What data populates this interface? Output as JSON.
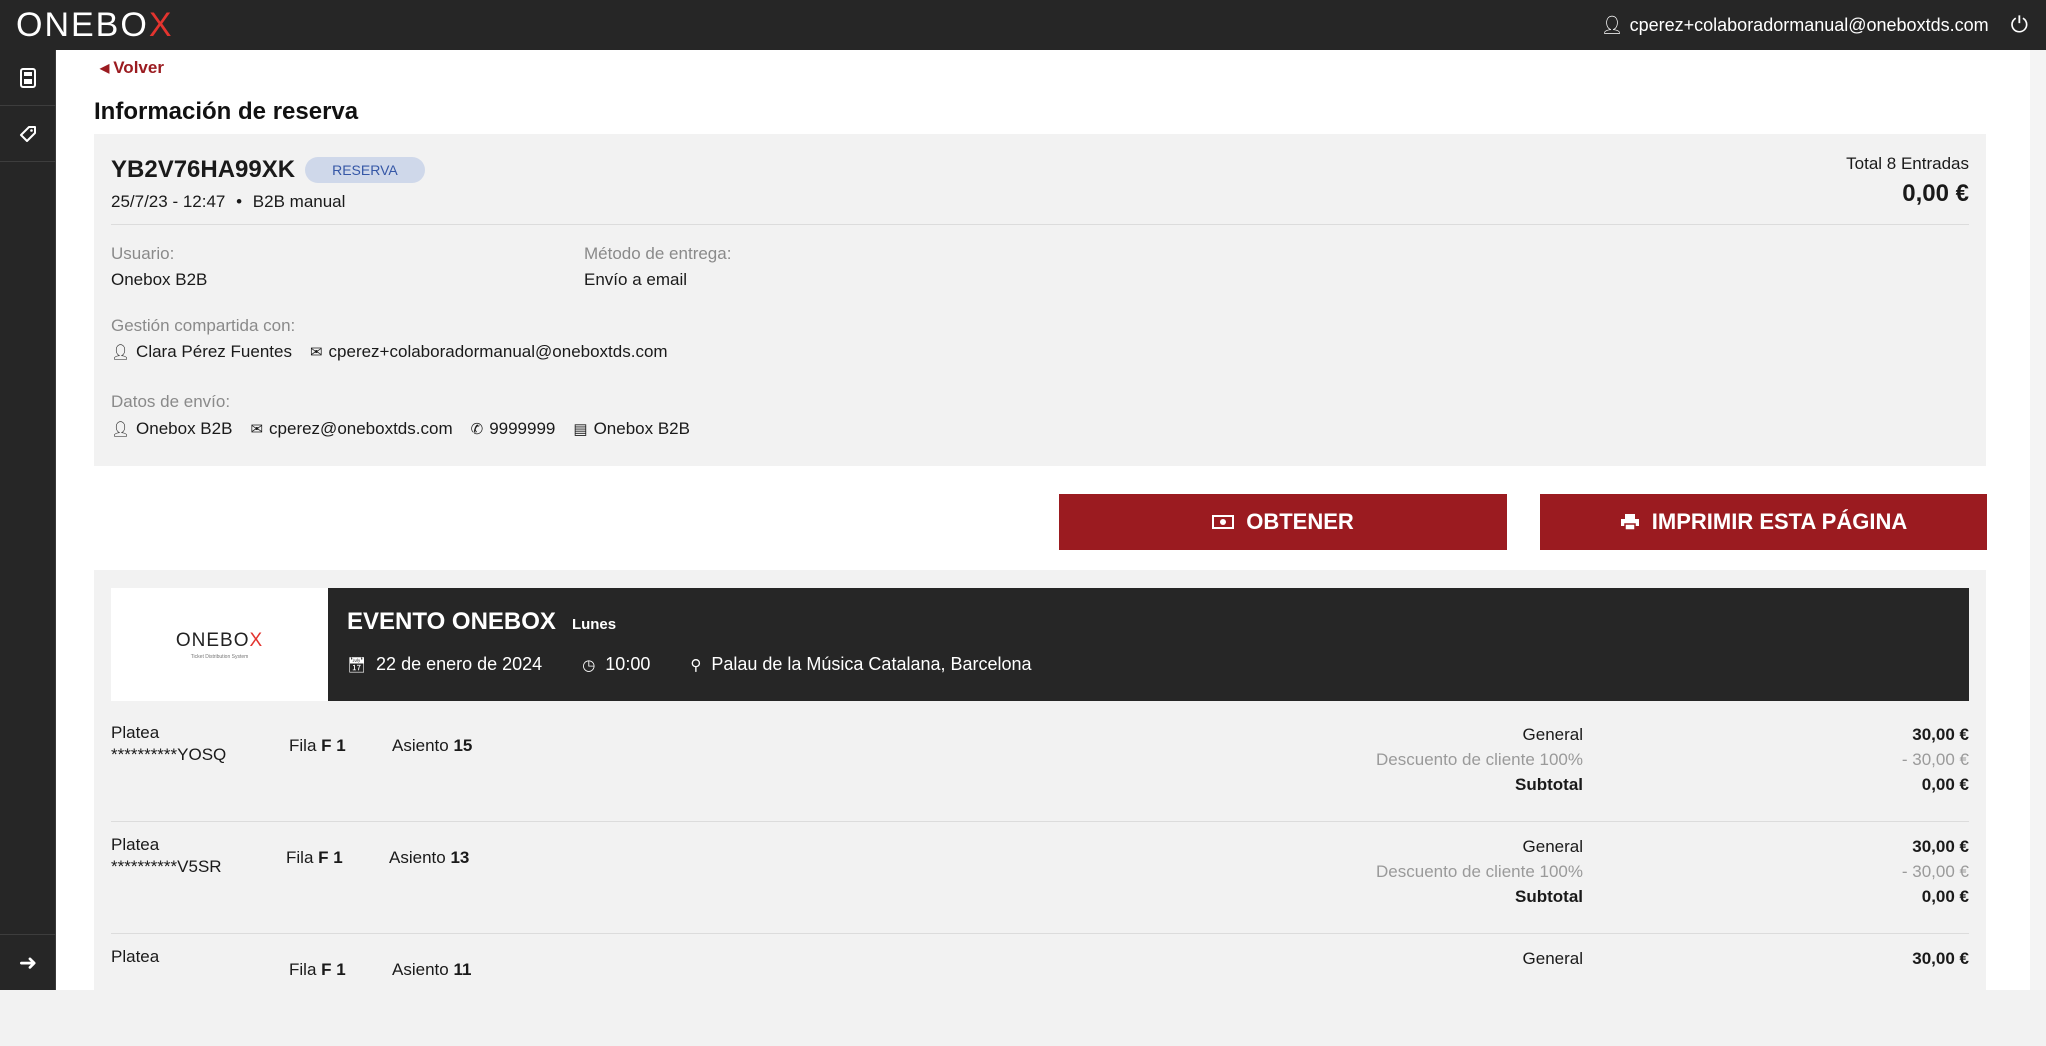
{
  "header": {
    "logo_main": "ONEBO",
    "logo_x": "X",
    "user_email": "cperez+colaboradormanual@oneboxtds.com"
  },
  "back_label": "Volver",
  "page_title": "Información de reserva",
  "booking": {
    "code": "YB2V76HA99XK",
    "status": "RESERVA",
    "datetime": "25/7/23 - 12:47",
    "separator": "•",
    "channel": "B2B manual",
    "total_label": "Total 8 Entradas",
    "total_amount": "0,00 €",
    "user_label": "Usuario:",
    "user_value": "Onebox B2B",
    "delivery_label": "Método de entrega:",
    "delivery_value": "Envío a email",
    "shared_label": "Gestión compartida con:",
    "shared_name": "Clara Pérez Fuentes",
    "shared_email": "cperez+colaboradormanual@oneboxtds.com",
    "shipping_label": "Datos de envío:",
    "shipping_name": "Onebox B2B",
    "shipping_email": "cperez@oneboxtds.com",
    "shipping_phone": "9999999",
    "shipping_company": "Onebox B2B"
  },
  "actions": {
    "get_label": "OBTENER",
    "print_label": "IMPRIMIR ESTA PÁGINA"
  },
  "event": {
    "logo_main": "ONEBO",
    "logo_x": "X",
    "logo_tag": "Ticket Distribution System",
    "title": "EVENTO ONEBOX",
    "day": "Lunes",
    "date": "22 de enero de 2024",
    "time": "10:00",
    "venue": "Palau de la Música Catalana, Barcelona"
  },
  "tickets": [
    {
      "zone": "Platea",
      "id": "**********YOSQ",
      "row_label": "Fila",
      "row": "F 1",
      "seat_label": "Asiento",
      "seat": "15",
      "type": "General",
      "price": "30,00 €",
      "discount_label": "Descuento de cliente 100%",
      "discount": "- 30,00 €",
      "subtotal_label": "Subtotal",
      "subtotal": "0,00 €"
    },
    {
      "zone": "Platea",
      "id": "**********V5SR",
      "row_label": "Fila",
      "row": "F 1",
      "seat_label": "Asiento",
      "seat": "13",
      "type": "General",
      "price": "30,00 €",
      "discount_label": "Descuento de cliente 100%",
      "discount": "- 30,00 €",
      "subtotal_label": "Subtotal",
      "subtotal": "0,00 €"
    },
    {
      "zone": "Platea",
      "id": "",
      "row_label": "Fila",
      "row": "F 1",
      "seat_label": "Asiento",
      "seat": "11",
      "type": "General",
      "price": "30,00 €",
      "discount_label": "",
      "discount": "",
      "subtotal_label": "",
      "subtotal": ""
    }
  ],
  "colors": {
    "topbar": "#262626",
    "accent": "#9b1b20",
    "badge_bg": "#cfd8ea",
    "badge_text": "#3557a6"
  },
  "icons": [
    "user-icon",
    "power-icon",
    "calculator-icon",
    "ticket-icon",
    "arrow-right-icon",
    "envelope-icon",
    "phone-icon",
    "id-card-icon",
    "money-icon",
    "printer-icon",
    "calendar-icon",
    "clock-icon",
    "map-marker-icon",
    "chevron-left-icon"
  ]
}
